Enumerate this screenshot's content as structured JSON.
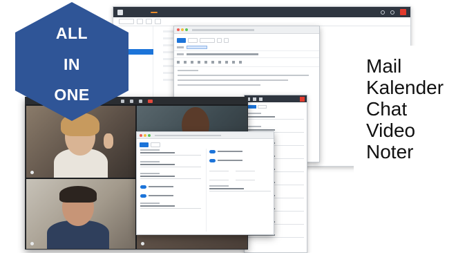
{
  "badge": {
    "line1": "ALL",
    "line2": "IN",
    "line3": "ONE",
    "color": "#2f5597"
  },
  "features": [
    "Mail",
    "Kalender",
    "Chat",
    "Video",
    "Noter"
  ],
  "colors": {
    "accent_blue": "#1c74d9",
    "topbar": "#2f3640",
    "new_button": "#e98b2a",
    "close_red": "#e23b2e"
  },
  "icons": {
    "app_logo": "app-logo-icon",
    "window_close": "close-icon",
    "end_call": "end-call-icon"
  }
}
